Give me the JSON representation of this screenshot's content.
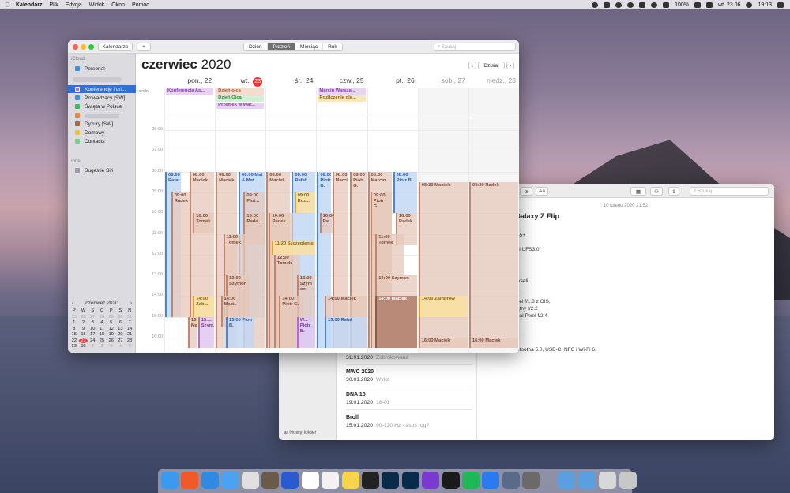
{
  "menubar": {
    "app": "Kalendarz",
    "items": [
      "Plik",
      "Edycja",
      "Widok",
      "Okno",
      "Pomoc"
    ],
    "battery": "100%",
    "date": "wt. 23.06",
    "time": "19:13"
  },
  "calendar": {
    "toolbar": {
      "calendars_btn": "Kalendarze",
      "add_btn": "+",
      "views": [
        "Dzień",
        "Tydzień",
        "Miesiąc",
        "Rok"
      ],
      "active_view": "Tydzień",
      "search_placeholder": "Szukaj",
      "prev": "‹",
      "today_btn": "Dzisiaj",
      "next": "›"
    },
    "sidebar": {
      "section_icloud": "iCloud",
      "icloud_items": [
        {
          "label": "Personal",
          "color": "#3b8fe8"
        }
      ],
      "items": [
        {
          "label": "Konferencje i url...",
          "color": "#b36ad6"
        },
        {
          "label": "Prowadzący [SW]",
          "color": "#3b8fe8"
        },
        {
          "label": "Święta w Polsce",
          "color": "#3fba5a"
        },
        {
          "label": "",
          "color": "#f08a3a"
        },
        {
          "label": "Dyżury [SW]",
          "color": "#a06a4a"
        },
        {
          "label": "Domowy",
          "color": "#f2c230"
        },
        {
          "label": "Contacts",
          "color": "#6fd38a"
        }
      ],
      "section_other": "Inne",
      "other_items": [
        {
          "label": "Sugestie Siri",
          "color": "#9a9aa8"
        }
      ]
    },
    "mini_calendar": {
      "title": "czerwiec 2020",
      "prev": "‹",
      "next": "›",
      "weekdays": [
        "P",
        "W",
        "Ś",
        "C",
        "P",
        "S",
        "N"
      ],
      "rows": [
        [
          "25",
          "26",
          "27",
          "28",
          "29",
          "30",
          "31"
        ],
        [
          "1",
          "2",
          "3",
          "4",
          "5",
          "6",
          "7"
        ],
        [
          "8",
          "9",
          "10",
          "11",
          "12",
          "13",
          "14"
        ],
        [
          "15",
          "16",
          "17",
          "18",
          "19",
          "20",
          "21"
        ],
        [
          "22",
          "23",
          "24",
          "25",
          "26",
          "27",
          "28"
        ],
        [
          "29",
          "30",
          "1",
          "2",
          "3",
          "4",
          "5"
        ]
      ],
      "today": "23"
    },
    "title_month": "czerwiec",
    "title_year": "2020",
    "days": [
      {
        "label": "pon., 22"
      },
      {
        "prefix": "wt.,",
        "num": "23"
      },
      {
        "label": "śr., 24"
      },
      {
        "label": "czw., 25"
      },
      {
        "label": "pt., 26"
      },
      {
        "label": "sob., 27"
      },
      {
        "label": "niedz., 28"
      }
    ],
    "allday_label": "całodn.",
    "allday_events": [
      {
        "day": 0,
        "row": 0,
        "text": "Konferencja Ap...",
        "kind": "p"
      },
      {
        "day": 1,
        "row": 0,
        "text": "Dzień ojca",
        "kind": "o"
      },
      {
        "day": 1,
        "row": 1,
        "text": "Dzień Ojca",
        "kind": "g"
      },
      {
        "day": 1,
        "row": 2,
        "text": "Przemek w War...",
        "kind": "p"
      },
      {
        "day": 3,
        "row": 0,
        "text": "Marcin Warsza...",
        "kind": "p"
      },
      {
        "day": 3,
        "row": 1,
        "text": "Rozliczenie dla...",
        "kind": "y"
      }
    ],
    "hours": [
      "06:00",
      "07:00",
      "08:00",
      "09:00",
      "10:00",
      "11:00",
      "12:00",
      "13:00",
      "14:00",
      "15:00",
      "16:00"
    ],
    "events": [
      {
        "d": 0,
        "col": 0,
        "w": 0.35,
        "s": 8.0,
        "e": 15.0,
        "t": "08:00 Rafał",
        "k": "b"
      },
      {
        "d": 0,
        "col": 0.12,
        "w": 0.4,
        "s": 9.0,
        "e": 15.0,
        "t": "09:00 Radek",
        "k": "o"
      },
      {
        "d": 0,
        "col": 0.48,
        "w": 0.52,
        "s": 8.0,
        "e": 15.0,
        "t": "08:00 Maciek",
        "k": "o"
      },
      {
        "d": 0,
        "col": 0.55,
        "w": 0.45,
        "s": 10.0,
        "e": 11.0,
        "t": "10:00 Tomek",
        "k": "o"
      },
      {
        "d": 0,
        "col": 0.55,
        "w": 0.45,
        "s": 14.0,
        "e": 15.5,
        "t": "14:00 Zab...",
        "k": "y"
      },
      {
        "d": 0,
        "col": 0.45,
        "w": 0.2,
        "s": 15.0,
        "e": 16.5,
        "t": "15:... Mac...",
        "k": "o"
      },
      {
        "d": 0,
        "col": 0.65,
        "w": 0.35,
        "s": 15.0,
        "e": 16.5,
        "t": "15:... Szym...",
        "k": "p"
      },
      {
        "d": 1,
        "col": 0,
        "w": 0.45,
        "s": 8.0,
        "e": 16.5,
        "t": "08:00 Maciek",
        "k": "o"
      },
      {
        "d": 1,
        "col": 0.45,
        "w": 0.55,
        "s": 8.0,
        "e": 15.0,
        "t": "08:00 Mat & Mat",
        "k": "b"
      },
      {
        "d": 1,
        "col": 0.55,
        "w": 0.45,
        "s": 9.0,
        "e": 16.5,
        "t": "09:00 Piot...",
        "k": "o"
      },
      {
        "d": 1,
        "col": 0.55,
        "w": 0.45,
        "s": 10.0,
        "e": 11.5,
        "t": "10:00 Rade...",
        "k": "o"
      },
      {
        "d": 1,
        "col": 0.15,
        "w": 0.5,
        "s": 11.0,
        "e": 15.0,
        "t": "11:00 Tomek",
        "k": "o"
      },
      {
        "d": 1,
        "col": 0.2,
        "w": 0.5,
        "s": 13.0,
        "e": 15.0,
        "t": "13:00 Szymon",
        "k": "o"
      },
      {
        "d": 1,
        "col": 0.1,
        "w": 0.35,
        "s": 14.0,
        "e": 15.5,
        "t": "14:00 Maci...",
        "k": "o"
      },
      {
        "d": 1,
        "col": 0.2,
        "w": 0.6,
        "s": 15.0,
        "e": 16.5,
        "t": "15:00 Piotr B.",
        "k": "b"
      },
      {
        "d": 2,
        "col": 0,
        "w": 0.5,
        "s": 8.0,
        "e": 16.5,
        "t": "08:00 Maciek",
        "k": "o"
      },
      {
        "d": 2,
        "col": 0.5,
        "w": 0.5,
        "s": 8.0,
        "e": 16.5,
        "t": "08:00 Rafał",
        "k": "b"
      },
      {
        "d": 2,
        "col": 0.55,
        "w": 0.45,
        "s": 9.0,
        "e": 10.0,
        "t": "09:00 Roz...",
        "k": "y"
      },
      {
        "d": 2,
        "col": 0.05,
        "w": 0.5,
        "s": 10.0,
        "e": 16.5,
        "t": "10:00 Radek",
        "k": "o"
      },
      {
        "d": 2,
        "col": 0.1,
        "w": 0.9,
        "s": 11.33,
        "e": 12.0,
        "t": "11:20 Szczepienie",
        "k": "y"
      },
      {
        "d": 2,
        "col": 0.15,
        "w": 0.55,
        "s": 12.0,
        "e": 16.5,
        "t": "12:00 Tomek",
        "k": "o"
      },
      {
        "d": 2,
        "col": 0.6,
        "w": 0.4,
        "s": 13.0,
        "e": 15.0,
        "t": "13:00 Szym on",
        "k": "o"
      },
      {
        "d": 2,
        "col": 0.25,
        "w": 0.5,
        "s": 14.0,
        "e": 16.5,
        "t": "14:00 Piotr G.",
        "k": "o"
      },
      {
        "d": 2,
        "col": 0.6,
        "w": 0.4,
        "s": 15.0,
        "e": 16.5,
        "t": "W... Piotr B.",
        "k": "p"
      },
      {
        "d": 3,
        "col": 0,
        "w": 0.3,
        "s": 8.0,
        "e": 16.5,
        "t": "08:00 Piotr B.",
        "k": "b"
      },
      {
        "d": 3,
        "col": 0.3,
        "w": 0.35,
        "s": 8.0,
        "e": 16.5,
        "t": "08:00 Marcin",
        "k": "o"
      },
      {
        "d": 3,
        "col": 0.65,
        "w": 0.35,
        "s": 8.0,
        "e": 16.5,
        "t": "08:00 Piotr G.",
        "k": "o"
      },
      {
        "d": 3,
        "col": 0.05,
        "w": 0.3,
        "s": 10.0,
        "e": 11.0,
        "t": "10:00 Ra...",
        "k": "o"
      },
      {
        "d": 3,
        "col": 0.15,
        "w": 0.85,
        "s": 14.0,
        "e": 15.0,
        "t": "14:00 Maciek",
        "k": "o"
      },
      {
        "d": 3,
        "col": 0.15,
        "w": 0.85,
        "s": 15.0,
        "e": 16.5,
        "t": "15:00 Rafał",
        "k": "b"
      },
      {
        "d": 4,
        "col": 0,
        "w": 0.5,
        "s": 8.0,
        "e": 16.5,
        "t": "08:00 Marcin",
        "k": "o"
      },
      {
        "d": 4,
        "col": 0.5,
        "w": 0.5,
        "s": 8.0,
        "e": 10.0,
        "t": "08:00 Piotr B.",
        "k": "b"
      },
      {
        "d": 4,
        "col": 0.05,
        "w": 0.45,
        "s": 9.0,
        "e": 16.5,
        "t": "09:00 Piotr G.",
        "k": "o"
      },
      {
        "d": 4,
        "col": 0.55,
        "w": 0.45,
        "s": 10.0,
        "e": 11.5,
        "t": "10:00 Radek",
        "k": "o"
      },
      {
        "d": 4,
        "col": 0.15,
        "w": 0.6,
        "s": 11.0,
        "e": 13.0,
        "t": "11:00 Tomek",
        "k": "o"
      },
      {
        "d": 4,
        "col": 0.15,
        "w": 0.85,
        "s": 13.0,
        "e": 14.0,
        "t": "13:00 Szymon",
        "k": "o"
      },
      {
        "d": 4,
        "col": 0.15,
        "w": 0.85,
        "s": 14.0,
        "e": 16.5,
        "t": "14:00 Maciek",
        "k": "dk"
      },
      {
        "d": 5,
        "col": 0,
        "w": 1,
        "s": 8.5,
        "e": 16.5,
        "t": "08:30 Maciek",
        "k": "o"
      },
      {
        "d": 5,
        "col": 0,
        "w": 1,
        "s": 14.0,
        "e": 15.0,
        "t": "14:00 Zambrów",
        "k": "y"
      },
      {
        "d": 5,
        "col": 0,
        "w": 1,
        "s": 16.0,
        "e": 16.5,
        "t": "16:00 Maciek",
        "k": "o"
      },
      {
        "d": 6,
        "col": 0,
        "w": 1,
        "s": 8.5,
        "e": 16.5,
        "t": "08:30 Radek",
        "k": "o"
      },
      {
        "d": 6,
        "col": 0,
        "w": 1,
        "s": 16.0,
        "e": 16.5,
        "t": "16:00 Maciek",
        "k": "o"
      }
    ]
  },
  "notes": {
    "search_placeholder": "Szukaj",
    "new_folder": "Nowy folder",
    "list": [
      {
        "title": "",
        "date": "31.01.2020",
        "snippet": "Zobrokowana"
      },
      {
        "title": "MWC 2020",
        "date": "30.01.2020",
        "snippet": "Wylot"
      },
      {
        "title": "DNA 18",
        "date": "19.01.2020",
        "snippet": "18-01"
      },
      {
        "title": "Broll",
        "date": "15.01.2020",
        "snippet": "90-120 Hz - asus rog?"
      }
    ],
    "body_date": "10 lutego 2020 21:52",
    "body_title": "Galaxy Z Flip",
    "body_lines": [
      "55+",
      "ci UFS3.0.",
      "ikseli",
      "xel f/1.8 z OIS,",
      "ątny f/2.2",
      "ual Pixel f/2.4",
      "etootha 5.0, USB-C, NFC i Wi-Fi 6."
    ]
  }
}
